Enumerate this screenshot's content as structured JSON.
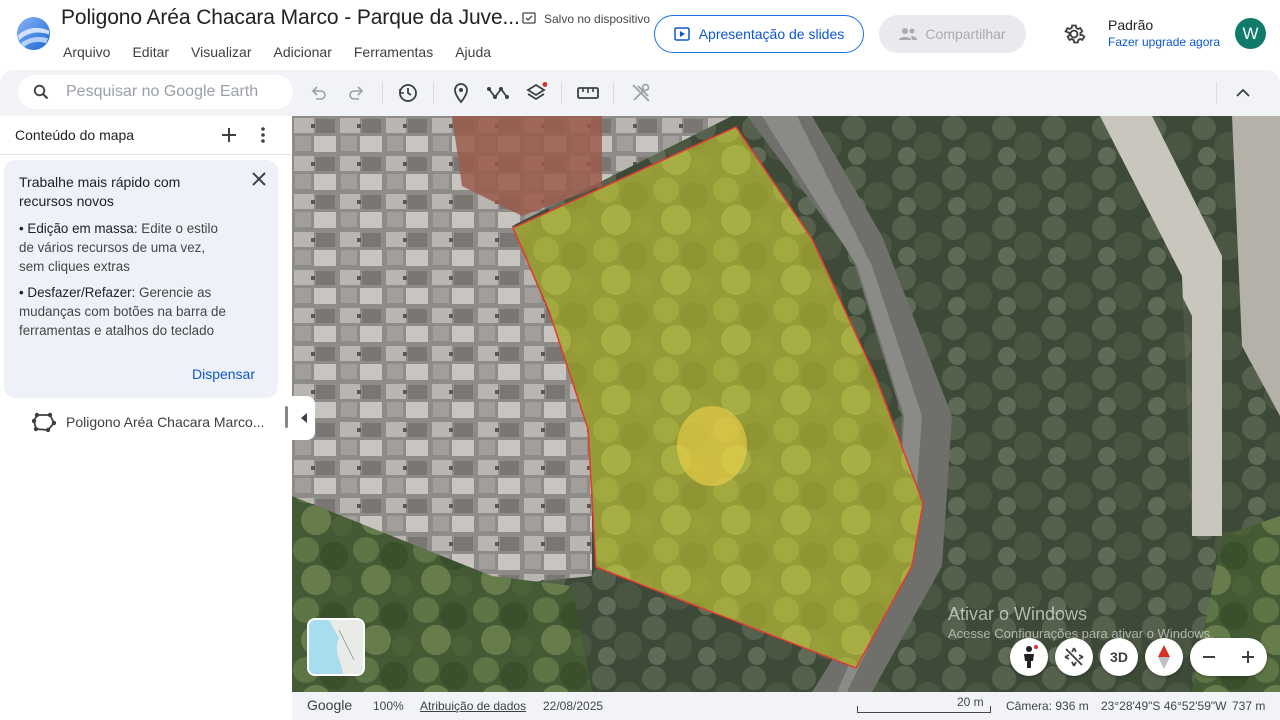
{
  "header": {
    "title": "Poligono Aréa Chacara Marco - Parque da Juve...",
    "saved_status": "Salvo no dispositivo",
    "menu": [
      "Arquivo",
      "Editar",
      "Visualizar",
      "Adicionar",
      "Ferramentas",
      "Ajuda"
    ],
    "slides_button": "Apresentação de slides",
    "share_button": "Compartilhar",
    "profile_name": "Padrão",
    "profile_upgrade": "Fazer upgrade agora",
    "avatar_initial": "W",
    "accent_color": "#1a73e8",
    "avatar_color": "#0f7b68"
  },
  "toolbar": {
    "search_placeholder": "Pesquisar no Google Earth",
    "search_value": "",
    "icons": [
      "undo-icon",
      "redo-icon",
      "history-icon",
      "placemark-icon",
      "path-icon",
      "layers-icon",
      "ruler-icon",
      "tools-off-icon",
      "collapse-up-icon"
    ]
  },
  "sidebar": {
    "title": "Conteúdo do mapa",
    "tip": {
      "title": "Trabalhe mais rápido com recursos novos",
      "item1_bold": "• Edição em massa:",
      "item1_text": " Edite o estilo de vários recursos de uma vez, sem cliques extras",
      "item2_bold": "• Desfazer/Refazer:",
      "item2_text": " Gerencie as mudanças com botões na barra de ferramentas e atalhos do teclado",
      "dismiss": "Dispensar"
    },
    "feature_label": "Poligono Aréa Chacara Marco..."
  },
  "map": {
    "watermark_line1": "Ativar o Windows",
    "watermark_line2": "Acesse Configurações para ativar o Windows.",
    "btn_3d": "3D",
    "polygon_fill": "#f7ec3a",
    "polygon_stroke": "#e53935"
  },
  "footer": {
    "brand": "Google",
    "zoom": "100%",
    "attribution": "Atribuição de dados",
    "date": "22/08/2025",
    "scale": "20 m",
    "camera": "Câmera: 936 m",
    "coords": "23°28'49\"S 46°52'59\"W",
    "elevation": "737 m"
  }
}
